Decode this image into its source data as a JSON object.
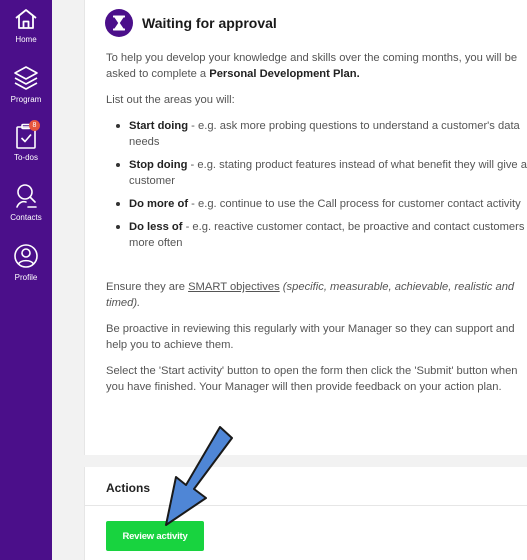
{
  "sidebar": {
    "items": [
      {
        "label": "Home",
        "icon": "home-icon"
      },
      {
        "label": "Program",
        "icon": "layers-icon"
      },
      {
        "label": "To-dos",
        "icon": "clipboard-check-icon",
        "badge": "8"
      },
      {
        "label": "Contacts",
        "icon": "contacts-search-icon"
      },
      {
        "label": "Profile",
        "icon": "user-circle-icon"
      }
    ]
  },
  "card": {
    "status_icon": "hourglass-icon",
    "title": "Waiting for approval",
    "intro_text": "To help you develop your knowledge and skills over the coming months, you will be asked to complete a ",
    "intro_bold": "Personal Development Plan.",
    "list_heading": "List out the areas you will:",
    "bullets": [
      {
        "bold": "Start doing",
        "text": " - e.g. ask more probing questions to understand a customer's data needs"
      },
      {
        "bold": "Stop doing",
        "text": " - e.g. stating product features instead of what benefit they will give a customer"
      },
      {
        "bold": "Do more of",
        "text": " - e.g. continue to use the Call process for customer contact activity"
      },
      {
        "bold": "Do less of",
        "text": " - e.g. reactive customer contact, be proactive and contact customers more often"
      }
    ],
    "smart_prefix": "Ensure they are ",
    "smart_link": "SMART objectives",
    "smart_italic": " (specific, measurable, achievable, realistic and timed).",
    "proactive_text": "Be proactive in reviewing this regularly with your Manager so they can support and help you to achieve them.",
    "instructions_text": "Select the 'Start activity' button to open the form then click the 'Submit' button when you have finished. Your Manager will then provide feedback on your action plan."
  },
  "actions": {
    "title": "Actions",
    "review_button": "Review activity"
  },
  "colors": {
    "sidebar": "#4b0f8a",
    "button": "#18d33f",
    "arrow": "#4f86d6",
    "badge": "#e6553d"
  }
}
